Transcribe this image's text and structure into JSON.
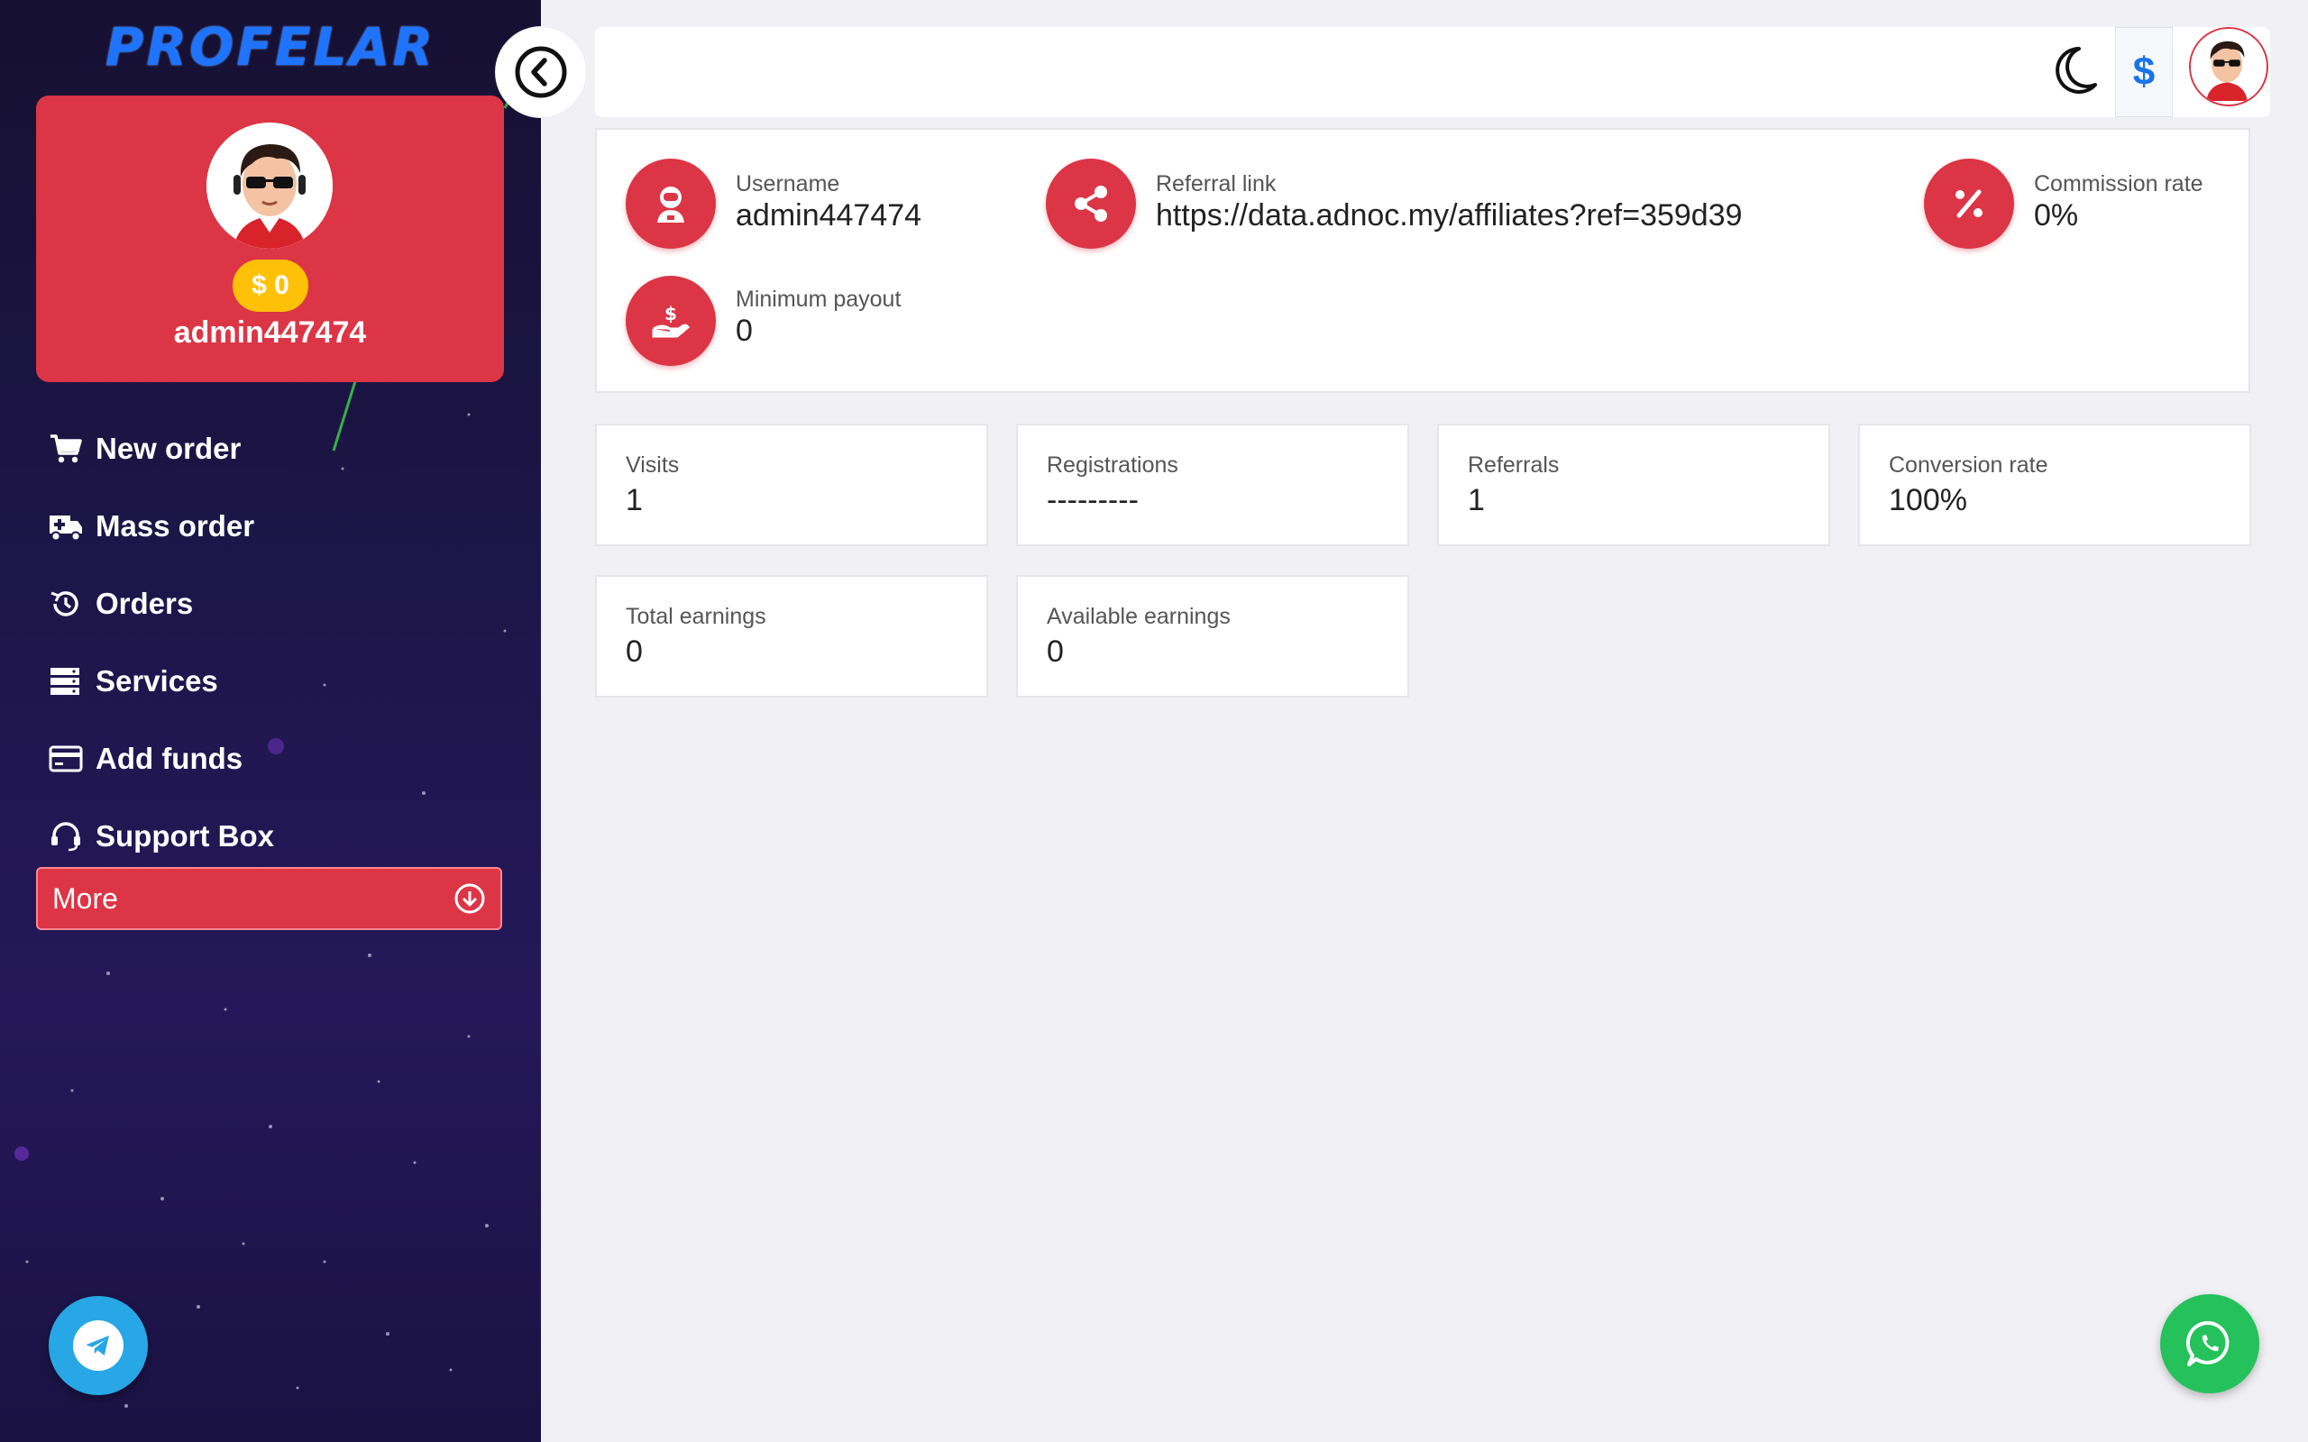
{
  "brand": {
    "logo_text": "PROFELAR",
    "accent_color": "#dc3545",
    "logo_color": "#1f74ff"
  },
  "profile": {
    "balance": "$ 0",
    "username": "admin447474"
  },
  "sidebar": {
    "items": [
      {
        "label": "New order",
        "icon": "cart-icon"
      },
      {
        "label": "Mass order",
        "icon": "truck-icon"
      },
      {
        "label": "Orders",
        "icon": "history-icon"
      },
      {
        "label": "Services",
        "icon": "server-list-icon"
      },
      {
        "label": "Add funds",
        "icon": "credit-card-icon"
      },
      {
        "label": "Support Box",
        "icon": "headset-icon"
      }
    ],
    "more_label": "More"
  },
  "topbar": {
    "currency_symbol": "$"
  },
  "affiliate_info": {
    "username": {
      "label": "Username",
      "value": "admin447474"
    },
    "referral_link": {
      "label": "Referral link",
      "value": "https://data.adnoc.my/affiliates?ref=359d39"
    },
    "commission_rate": {
      "label": "Commission rate",
      "value": "0%"
    },
    "minimum_payout": {
      "label": "Minimum payout",
      "value": "0"
    }
  },
  "stats": [
    {
      "label": "Visits",
      "value": "1"
    },
    {
      "label": "Registrations",
      "value": "---------"
    },
    {
      "label": "Referrals",
      "value": "1"
    },
    {
      "label": "Conversion rate",
      "value": "100%"
    },
    {
      "label": "Total earnings",
      "value": "0"
    },
    {
      "label": "Available earnings",
      "value": "0"
    }
  ]
}
